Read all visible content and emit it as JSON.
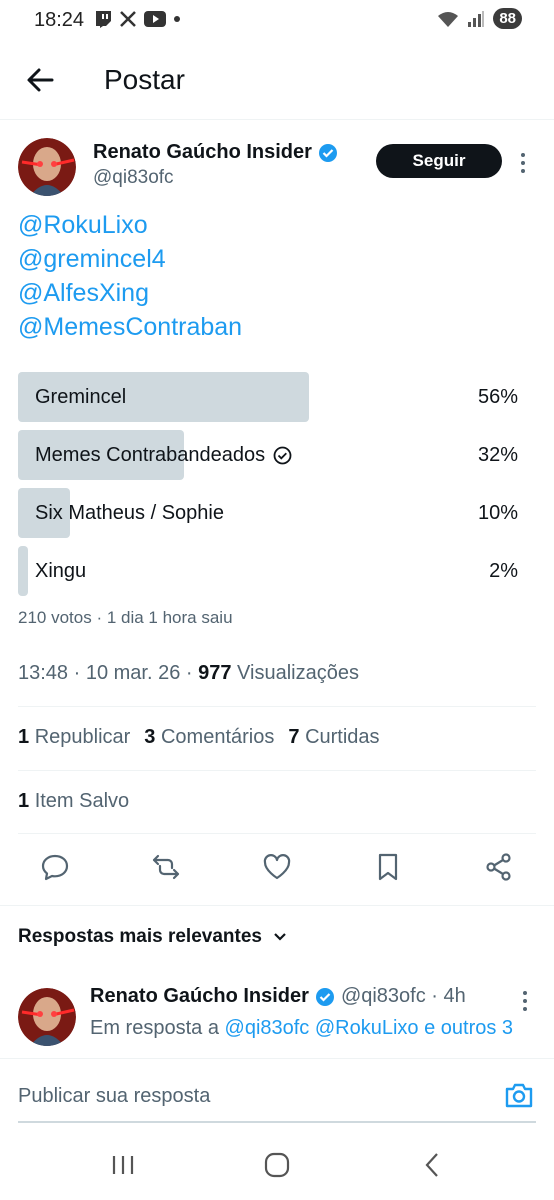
{
  "status_bar": {
    "time": "18:24",
    "battery": "88",
    "icons": [
      "twitch-icon",
      "x-icon",
      "youtube-icon",
      "dot-icon",
      "wifi-icon",
      "signal-icon"
    ]
  },
  "header": {
    "title": "Postar"
  },
  "post": {
    "author_name": "Renato Gaúcho Insider",
    "author_handle": "@qi83ofc",
    "follow_label": "Seguir",
    "mentions": [
      "@RokuLixo",
      "@gremincel4",
      "@AlfesXing",
      "@MemesContraban"
    ],
    "poll": {
      "options": [
        {
          "label": "Gremincel",
          "percent_text": "56%",
          "percent": 56,
          "selected": false
        },
        {
          "label": "Memes Contrabandeados",
          "percent_text": "32%",
          "percent": 32,
          "selected": true
        },
        {
          "label": "Six Matheus / Sophie",
          "percent_text": "10%",
          "percent": 10,
          "selected": false
        },
        {
          "label": "Xingu",
          "percent_text": "2%",
          "percent": 2,
          "selected": false
        }
      ],
      "meta": "210 votos · 1 dia 1 hora saiu"
    },
    "timestamp_prefix": "13:48 · 10 mar. 26 · ",
    "views_count": "977",
    "views_label": "Visualizações",
    "reposts_count": "1",
    "reposts_label": "Republicar",
    "comments_count": "3",
    "comments_label": "Comentários",
    "likes_count": "7",
    "likes_label": "Curtidas",
    "saved_count": "1",
    "saved_label": "Item Salvo"
  },
  "replies": {
    "sort_label": "Respostas mais relevantes",
    "items": [
      {
        "author_name": "Renato Gaúcho Insider",
        "author_handle": "@qi83ofc · 4h",
        "reply_prefix": "Em resposta a ",
        "reply_targets": "@qi83ofc @RokuLixo e outros 3"
      }
    ]
  },
  "compose": {
    "placeholder": "Publicar sua resposta"
  },
  "colors": {
    "accent": "#1d9bf0",
    "poll_bar": "#cfd9de",
    "text": "#0f1419",
    "muted": "#536471"
  }
}
